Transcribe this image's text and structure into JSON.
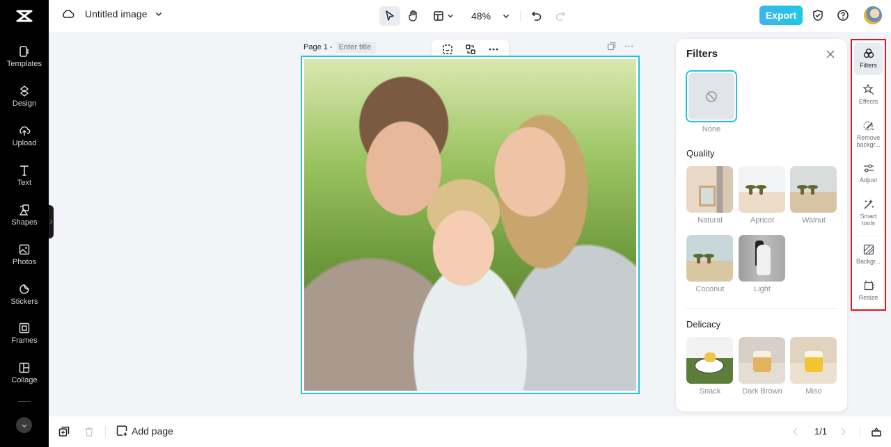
{
  "app": {
    "document_title": "Untitled image",
    "zoom_level": "48%",
    "export_label": "Export"
  },
  "sidebar": {
    "items": [
      {
        "label": "Templates",
        "icon": "templates-icon"
      },
      {
        "label": "Design",
        "icon": "design-icon"
      },
      {
        "label": "Upload",
        "icon": "upload-icon"
      },
      {
        "label": "Text",
        "icon": "text-icon"
      },
      {
        "label": "Shapes",
        "icon": "shapes-icon"
      },
      {
        "label": "Photos",
        "icon": "photos-icon"
      },
      {
        "label": "Stickers",
        "icon": "stickers-icon"
      },
      {
        "label": "Frames",
        "icon": "frames-icon"
      },
      {
        "label": "Collage",
        "icon": "collage-icon"
      }
    ]
  },
  "canvas": {
    "page_label": "Page 1 -",
    "page_title_placeholder": "Enter title",
    "image_description": "Family portrait: smiling man, woman and child outdoors"
  },
  "filters_panel": {
    "title": "Filters",
    "none_label": "None",
    "sections": [
      {
        "title": "Quality",
        "items": [
          "Natural",
          "Apricot",
          "Walnut",
          "Coconut",
          "Light"
        ]
      },
      {
        "title": "Delicacy",
        "items": [
          "Snack",
          "Dark Brown",
          "Miso"
        ]
      }
    ]
  },
  "right_rail": {
    "items": [
      {
        "label": "Filters",
        "active": true
      },
      {
        "label": "Effects"
      },
      {
        "label": "Remove backgr..."
      },
      {
        "label": "Adjust"
      },
      {
        "label": "Smart tools"
      },
      {
        "label": "Backgr..."
      },
      {
        "label": "Resize"
      }
    ]
  },
  "bottom_bar": {
    "add_page_label": "Add page",
    "page_indicator": "1/1"
  },
  "colors": {
    "accent": "#1fc4dc",
    "export_gradient_start": "#3cb5f0",
    "export_gradient_end": "#1ec9e4",
    "highlight_border": "#e8131a",
    "sidebar_bg": "#000000"
  }
}
